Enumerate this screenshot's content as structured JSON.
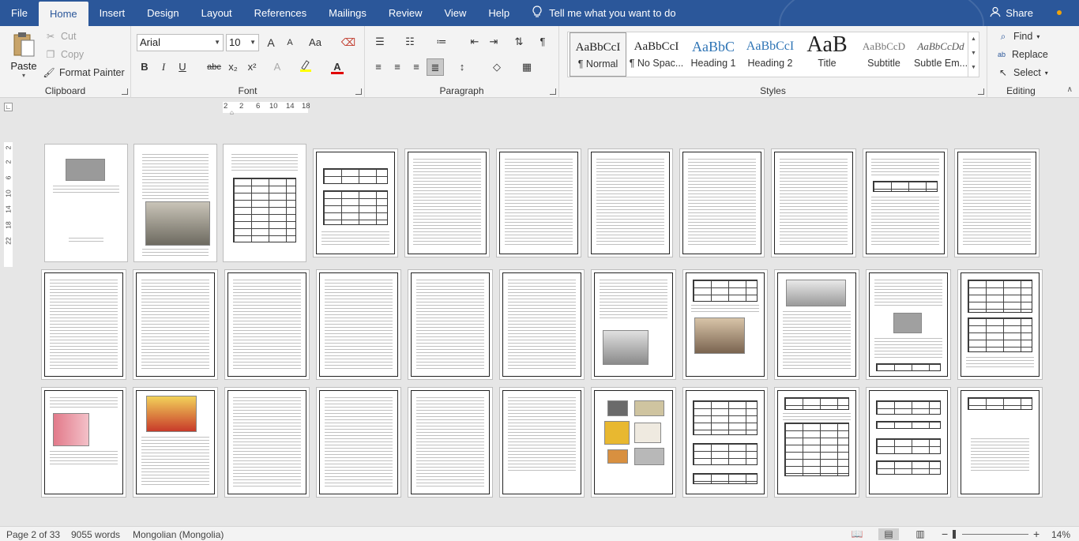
{
  "menu": {
    "tabs": [
      {
        "label": "File"
      },
      {
        "label": "Home"
      },
      {
        "label": "Insert"
      },
      {
        "label": "Design"
      },
      {
        "label": "Layout"
      },
      {
        "label": "References"
      },
      {
        "label": "Mailings"
      },
      {
        "label": "Review"
      },
      {
        "label": "View"
      },
      {
        "label": "Help"
      }
    ],
    "active_tab": "Home",
    "tell_me": "Tell me what you want to do",
    "share": "Share",
    "accent_color": "#2b579a"
  },
  "ribbon": {
    "clipboard": {
      "label": "Clipboard",
      "paste": "Paste",
      "cut": "Cut",
      "copy": "Copy",
      "format_painter": "Format Painter"
    },
    "font": {
      "label": "Font",
      "font_name": "Arial",
      "font_size": "10",
      "grow": "A",
      "shrink": "A",
      "case": "Aa",
      "bold": "B",
      "italic": "I",
      "underline": "U",
      "strike": "abc",
      "subscript": "x₂",
      "superscript": "x²",
      "effects": "A",
      "font_color": "A"
    },
    "paragraph": {
      "label": "Paragraph"
    },
    "styles": {
      "label": "Styles",
      "items": [
        {
          "preview": "AaBbCcI",
          "name": "¶ Normal"
        },
        {
          "preview": "AaBbCcI",
          "name": "¶ No Spac..."
        },
        {
          "preview": "AaBbC",
          "name": "Heading 1"
        },
        {
          "preview": "AaBbCcI",
          "name": "Heading 2"
        },
        {
          "preview": "AaB",
          "name": "Title"
        },
        {
          "preview": "AaBbCcD",
          "name": "Subtitle"
        },
        {
          "preview": "AaBbCcDd",
          "name": "Subtle Em..."
        }
      ]
    },
    "editing": {
      "label": "Editing",
      "find": "Find",
      "replace": "Replace",
      "select": "Select"
    }
  },
  "ruler": {
    "marks": [
      "2",
      "2",
      "6",
      "10",
      "14",
      "18"
    ],
    "vmarks": [
      "2",
      "2",
      "6",
      "10",
      "14",
      "18",
      "22"
    ]
  },
  "statusbar": {
    "page": "Page 2 of 33",
    "words": "9055 words",
    "language": "Mongolian (Mongolia)",
    "zoom": "14%",
    "minus": "−",
    "plus": "+"
  }
}
